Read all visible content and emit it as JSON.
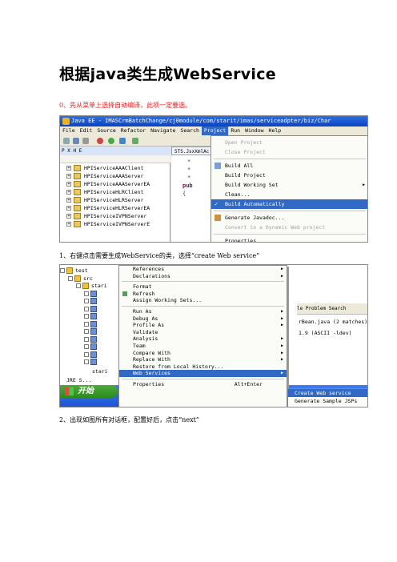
{
  "doc": {
    "title": "根据java类生成WebService",
    "step0": "0、先从菜单上选择自动编译，此项一定要选。",
    "step1": "1、右键点击需要生成WebService的类，选择“create Web service”",
    "step2": "2、出现如图所有对话框，配置好后，点击“next”"
  },
  "shot1": {
    "window_title": "Java EE - IMASCrmBatchChange/cj0module/com/starit/imas/serviceadpter/biz/Char",
    "menubar": [
      "File",
      "Edit",
      "Source",
      "Refactor",
      "Navigate",
      "Search",
      "Project",
      "Run",
      "Window",
      "Help"
    ],
    "left_tab": "P  X  H  E",
    "tree": [
      "HPIServiceAAAClient",
      "HPIServiceAAAServer",
      "HPIServiceAAAServerEA",
      "HPIServiceHLRClient",
      "HPIServiceHLRServer",
      "HPIServiceHLRServerEA",
      "HPIServiceIVPNServer",
      "HPIServiceIVPNServerE"
    ],
    "editor_tab": "STS.JsxXmlAc",
    "code": [
      "*",
      "*",
      "*",
      "pub",
      "{"
    ],
    "project_menu": [
      {
        "label": "Open Project",
        "state": "disabled"
      },
      {
        "label": "Close Project",
        "state": "disabled"
      },
      {
        "label": "sep"
      },
      {
        "label": "Build All",
        "state": "normal",
        "icon": "build-all-icon"
      },
      {
        "label": "Build Project",
        "state": "normal"
      },
      {
        "label": "Build Working Set",
        "state": "normal",
        "submenu": true
      },
      {
        "label": "Clean...",
        "state": "normal"
      },
      {
        "label": "Build Automatically",
        "state": "highlighted",
        "icon": "check-icon"
      },
      {
        "label": "sep"
      },
      {
        "label": "Generate Javadoc...",
        "state": "normal",
        "icon": "javadoc-icon"
      },
      {
        "label": "Convert to a Dynamic Web project",
        "state": "disabled"
      },
      {
        "label": "sep"
      },
      {
        "label": "Properties",
        "state": "normal"
      }
    ]
  },
  "shot2": {
    "tree": [
      {
        "label": "test",
        "level": 0
      },
      {
        "label": "src",
        "level": 1
      },
      {
        "label": "stari",
        "level": 2
      },
      {
        "label": "",
        "level": 3
      },
      {
        "label": "",
        "level": 3
      },
      {
        "label": "",
        "level": 3
      },
      {
        "label": "",
        "level": 3
      },
      {
        "label": "",
        "level": 3
      },
      {
        "label": "",
        "level": 3
      },
      {
        "label": "",
        "level": 3
      },
      {
        "label": "",
        "level": 3
      },
      {
        "label": "",
        "level": 3
      },
      {
        "label": "",
        "level": 3
      }
    ],
    "tree_bottom": "stari",
    "tree_footer": "JRE S...",
    "right_tabs": "le  Problem  Search",
    "right_lines": [
      "rBean.java (2 matches) i",
      "1.9  (ASCII -ldev)"
    ],
    "start_label": "开始",
    "context_menu": [
      {
        "label": "References",
        "submenu": true
      },
      {
        "label": "Declarations",
        "submenu": true
      },
      {
        "label": "sep"
      },
      {
        "label": "Format"
      },
      {
        "label": "Refresh",
        "icon": "refresh-icon"
      },
      {
        "label": "Assign Working Sets..."
      },
      {
        "label": "sep"
      },
      {
        "label": "Run As",
        "submenu": true
      },
      {
        "label": "Debug As",
        "submenu": true
      },
      {
        "label": "Profile As",
        "submenu": true
      },
      {
        "label": "Validate"
      },
      {
        "label": "Analysis",
        "submenu": true
      },
      {
        "label": "Team",
        "submenu": true
      },
      {
        "label": "Compare With",
        "submenu": true
      },
      {
        "label": "Replace With",
        "submenu": true
      },
      {
        "label": "Restore from Local History..."
      },
      {
        "label": "Web Services",
        "submenu": true,
        "highlighted": true
      },
      {
        "label": "sep"
      },
      {
        "label": "Properties",
        "shortcut": "Alt+Enter"
      }
    ],
    "submenu": [
      {
        "label": "Create Web service",
        "highlighted": true
      },
      {
        "label": "Generate Sample JSPs"
      }
    ]
  }
}
